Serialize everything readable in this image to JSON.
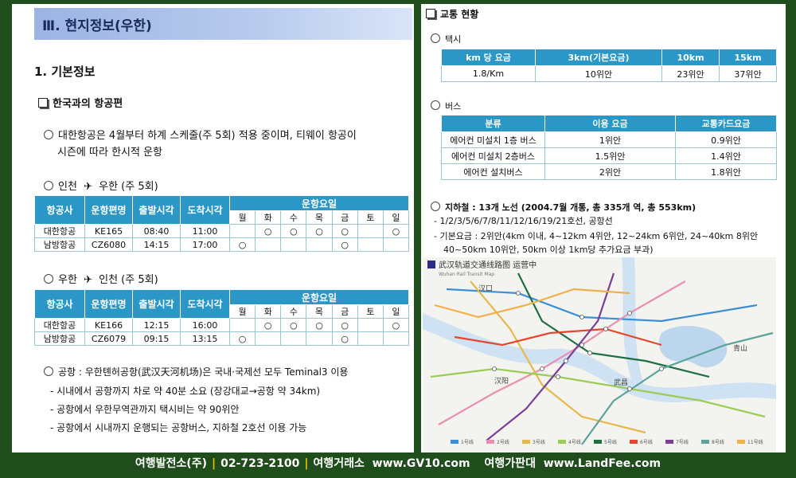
{
  "left": {
    "section_title": "Ⅲ. 현지정보(우한)",
    "heading1": "1. 기본정보",
    "heading2": "한국과의 항공편",
    "note_line1": "대한항공은 4월부터 하계 스케줄(주 5회) 적용 중이며, 티웨이 항공이",
    "note_line2": "시즌에 따라 한시적 운항",
    "route1": {
      "from": "인천",
      "to": "우한",
      "freq": "(주 5회)",
      "headers": [
        "항공사",
        "운항편명",
        "출발시각",
        "도착시각",
        "운항요일"
      ],
      "days": [
        "월",
        "화",
        "수",
        "목",
        "금",
        "토",
        "일"
      ],
      "rows": [
        {
          "airline": "대한항공",
          "flight": "KE165",
          "dep": "08:40",
          "arr": "11:00",
          "days": [
            "",
            "○",
            "○",
            "○",
            "○",
            "",
            "○"
          ]
        },
        {
          "airline": "남방항공",
          "flight": "CZ6080",
          "dep": "14:15",
          "arr": "17:00",
          "days": [
            "○",
            "",
            "",
            "",
            "○",
            "",
            ""
          ]
        }
      ]
    },
    "route2": {
      "from": "우한",
      "to": "인천",
      "freq": "(주 5회)",
      "headers": [
        "항공사",
        "운항편명",
        "출발시각",
        "도착시각",
        "운항요일"
      ],
      "days": [
        "월",
        "화",
        "수",
        "목",
        "금",
        "토",
        "일"
      ],
      "rows": [
        {
          "airline": "대한항공",
          "flight": "KE166",
          "dep": "12:15",
          "arr": "16:00",
          "days": [
            "",
            "○",
            "○",
            "○",
            "○",
            "",
            "○"
          ]
        },
        {
          "airline": "남방항공",
          "flight": "CZ6079",
          "dep": "09:15",
          "arr": "13:15",
          "days": [
            "○",
            "",
            "",
            "",
            "○",
            "",
            ""
          ]
        }
      ]
    },
    "airport_line": "공항 : 우한톈허공항(武汉天河机场)은 국내·국제선 모두 Teminal3 이용",
    "bullets": [
      "- 시내에서 공항까지 차로 약 40분 소요 (장강대교→공항 약 34km)",
      "- 공항에서 우한무역관까지 택시비는 약 90위안",
      "- 공항에서 시내까지 운행되는 공항버스, 지하철 2호선 이용 가능"
    ]
  },
  "right": {
    "heading": "교통 현황",
    "taxi": {
      "label": "택시",
      "headers": [
        "km 당 요금",
        "3km(기본요금)",
        "10km",
        "15km"
      ],
      "values": [
        "1.8/Km",
        "10위안",
        "23위안",
        "37위안"
      ]
    },
    "bus": {
      "label": "버스",
      "headers": [
        "분류",
        "이용 요금",
        "교통카드요금"
      ],
      "rows": [
        [
          "에어컨 미설치 1층 버스",
          "1위안",
          "0.9위안"
        ],
        [
          "에어컨 미설치 2층버스",
          "1.5위안",
          "1.4위안"
        ],
        [
          "에어컨 설치버스",
          "2위안",
          "1.8위안"
        ]
      ]
    },
    "subway": {
      "label": "지하철 : 13개 노선 (2004.7월 개통, 총 335개 역, 총 553km)",
      "line1": "- 1/2/3/5/6/7/8/11/12/16/19/21호선, 공항선",
      "line2": "- 기본요금 : 2위안(4km 이내, 4~12km 4위안, 12~24km 6위안, 24~40km 8위안",
      "line3": "40~50km 10위안, 50km 이상 1km당 추가요금 부과)"
    },
    "map": {
      "title": "武汉轨道交通线路图 运营中",
      "subtitle": "Wuhan Rail Transit Map",
      "labels": [
        "汉口",
        "青山",
        "武昌",
        "汉阳"
      ],
      "legend": [
        "1号线",
        "2号线",
        "3号线",
        "4号线",
        "5号线",
        "6号线",
        "7号线",
        "8号线",
        "11号线"
      ],
      "legend_colors": [
        "#3c8fd6",
        "#e98fb3",
        "#e7b84b",
        "#9ccc55",
        "#1f6f43",
        "#e6462f",
        "#7b3f98",
        "#5aa39b",
        "#f1b04a"
      ]
    }
  },
  "footer": {
    "part1": "여행발전소(주)",
    "part2": "02-723-2100",
    "part3": "여행거래소  www.GV10.com",
    "part4": "여행가판대  www.LandFee.com"
  }
}
